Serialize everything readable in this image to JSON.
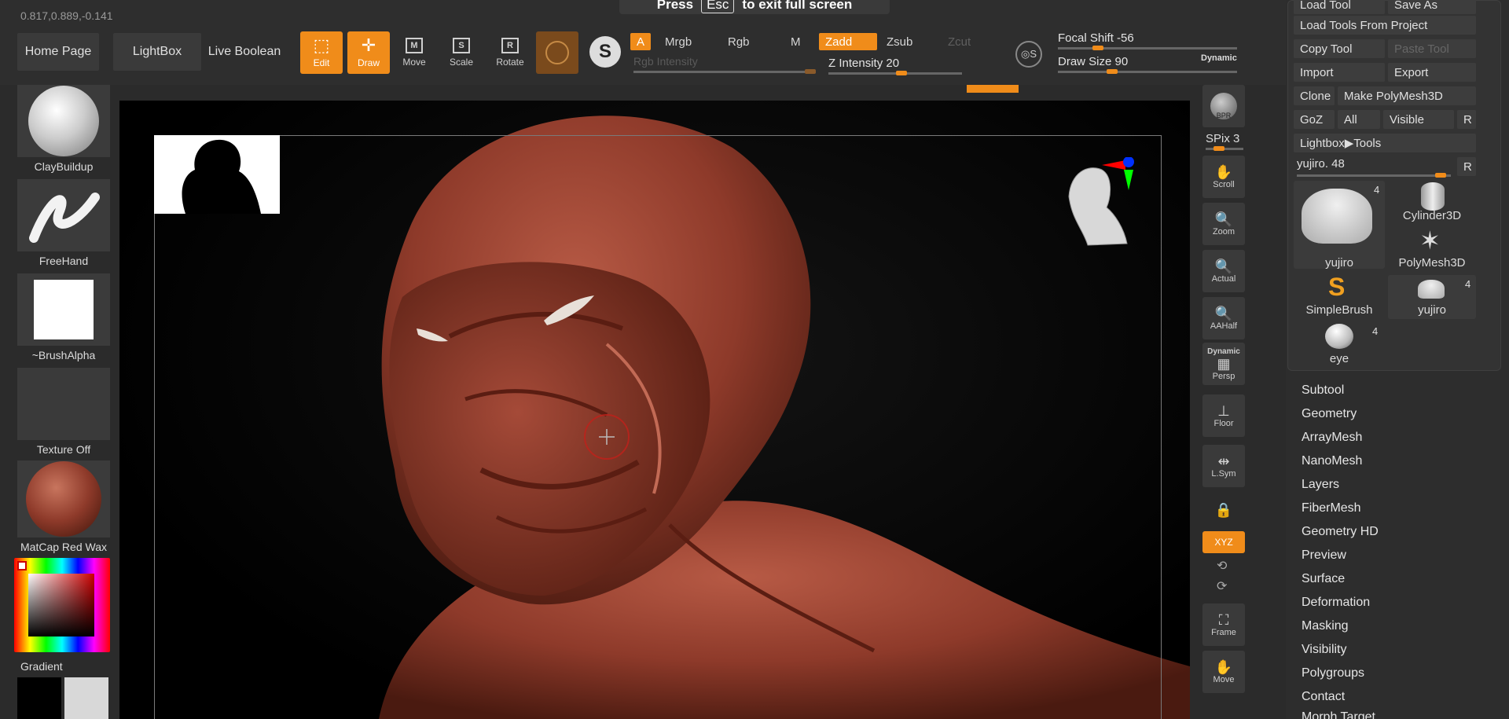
{
  "coords": "0.817,0.889,-0.141",
  "fullscreen_banner": {
    "press": "Press",
    "key": "Esc",
    "suffix": "to exit full screen"
  },
  "nav": {
    "home": "Home Page",
    "lightbox": "LightBox",
    "live_boolean": "Live Boolean"
  },
  "tools": {
    "edit": "Edit",
    "draw": "Draw",
    "move": "Move",
    "scale": "Scale",
    "rotate": "Rotate"
  },
  "modes": {
    "a": "A",
    "mrgb": "Mrgb",
    "rgb": "Rgb",
    "m": "M",
    "zadd": "Zadd",
    "zsub": "Zsub",
    "zcut": "Zcut",
    "rgb_intensity": "Rgb Intensity"
  },
  "z_intensity": {
    "label": "Z Intensity",
    "value": "20"
  },
  "focal_shift": {
    "label": "Focal Shift",
    "value": "-56"
  },
  "draw_size": {
    "label": "Draw Size",
    "value": "90",
    "dynamic": "Dynamic"
  },
  "shelf": {
    "brush": "ClayBuildup",
    "stroke": "FreeHand",
    "alpha": "~BrushAlpha",
    "texture": "Texture Off",
    "material": "MatCap Red Wax",
    "gradient": "Gradient"
  },
  "right_strip": {
    "bpr": "BPR",
    "spix_label": "SPix",
    "spix_value": "3",
    "scroll": "Scroll",
    "zoom": "Zoom",
    "actual": "Actual",
    "aahalf": "AAHalf",
    "persp_top": "Dynamic",
    "persp": "Persp",
    "floor": "Floor",
    "lsym": "L.Sym",
    "xyz": "XYZ",
    "frame": "Frame",
    "move": "Move"
  },
  "tool_panel": {
    "load_tool": "Load Tool",
    "save_as": "Save As",
    "load_from_project": "Load Tools From Project",
    "copy_tool": "Copy Tool",
    "paste_tool": "Paste Tool",
    "import": "Import",
    "export": "Export",
    "clone": "Clone",
    "make_polymesh": "Make PolyMesh3D",
    "goz": "GoZ",
    "all": "All",
    "visible": "Visible",
    "r": "R",
    "lightbox_tools": "Lightbox▶Tools",
    "current_tool": "yujiro. 48",
    "tools": [
      {
        "name": "yujiro",
        "count": "4"
      },
      {
        "name": "Cylinder3D",
        "count": ""
      },
      {
        "name": "PolyMesh3D",
        "count": ""
      },
      {
        "name": "SimpleBrush",
        "count": ""
      },
      {
        "name": "yujiro",
        "count": "4"
      },
      {
        "name": "eye",
        "count": "4"
      }
    ]
  },
  "subpalettes": [
    "Subtool",
    "Geometry",
    "ArrayMesh",
    "NanoMesh",
    "Layers",
    "FiberMesh",
    "Geometry HD",
    "Preview",
    "Surface",
    "Deformation",
    "Masking",
    "Visibility",
    "Polygroups",
    "Contact",
    "Morph Target"
  ],
  "colors": {
    "accent": "#f08c1a",
    "clay": "#8e3a2a",
    "panel": "#2d2d2d"
  }
}
